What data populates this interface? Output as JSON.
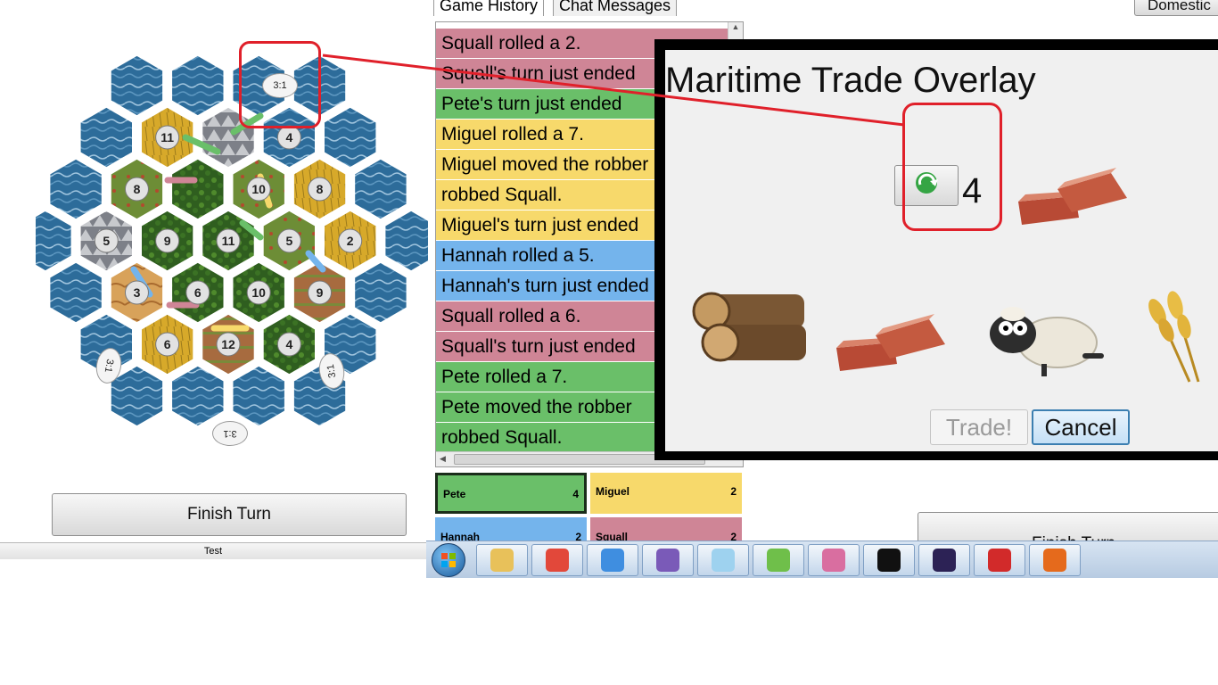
{
  "board": {
    "numbers": [
      "11",
      "10",
      "8",
      "5",
      "8",
      "9",
      "5",
      "11",
      "2",
      "6",
      "9",
      "6",
      "4",
      "10",
      "12",
      "4",
      "3"
    ],
    "ports": [
      "3:1",
      "3:1",
      "3:1",
      "3:1"
    ]
  },
  "left_panel": {
    "finish_turn_label": "Finish Turn",
    "status_text": "Test"
  },
  "history": {
    "tabs": [
      "Game History",
      "Chat Messages"
    ],
    "entries": [
      {
        "text": "Squall rolled a 2.",
        "color": "#cf8596"
      },
      {
        "text": "Squall's turn just ended",
        "color": "#cf8596"
      },
      {
        "text": "Pete's turn just ended",
        "color": "#6abf69"
      },
      {
        "text": "Miguel rolled a 7.",
        "color": "#f7d96b"
      },
      {
        "text": "Miguel moved the robber",
        "color": "#f7d96b"
      },
      {
        "text": "robbed Squall.",
        "color": "#f7d96b"
      },
      {
        "text": "Miguel's turn just ended",
        "color": "#f7d96b"
      },
      {
        "text": "Hannah rolled a 5.",
        "color": "#74b4ec"
      },
      {
        "text": "Hannah's turn just ended",
        "color": "#74b4ec"
      },
      {
        "text": "Squall rolled a 6.",
        "color": "#cf8596"
      },
      {
        "text": "Squall's turn just ended",
        "color": "#cf8596"
      },
      {
        "text": "Pete rolled a 7.",
        "color": "#6abf69"
      },
      {
        "text": "Pete moved the robber",
        "color": "#6abf69"
      },
      {
        "text": "robbed Squall.",
        "color": "#6abf69"
      }
    ]
  },
  "players": [
    {
      "name": "Pete",
      "count": "4",
      "color": "#6abf69"
    },
    {
      "name": "Miguel",
      "count": "2",
      "color": "#f7d96b"
    },
    {
      "name": "Hannah",
      "count": "2",
      "color": "#74b4ec"
    },
    {
      "name": "Squall",
      "count": "2",
      "color": "#cf8596"
    }
  ],
  "right_panel": {
    "domestic_label": "Domestic",
    "finish_turn_label": "Finish Turn"
  },
  "overlay": {
    "title": "Maritime Trade Overlay",
    "give_amount": "4",
    "trade_label": "Trade!",
    "cancel_label": "Cancel"
  },
  "annotations": {
    "port_callout": "3:1"
  },
  "colors": {
    "highlight_red": "#e0202a",
    "overlay_border": "#000000"
  },
  "taskbar": {
    "icons": [
      "start-orb-icon",
      "file-explorer-icon",
      "git-icon",
      "chrome-icon",
      "github-icon",
      "notepad-icon",
      "editor-icon",
      "paint-icon",
      "terminal-icon",
      "eclipse-icon",
      "phone-emulator-icon",
      "java-icon"
    ]
  }
}
